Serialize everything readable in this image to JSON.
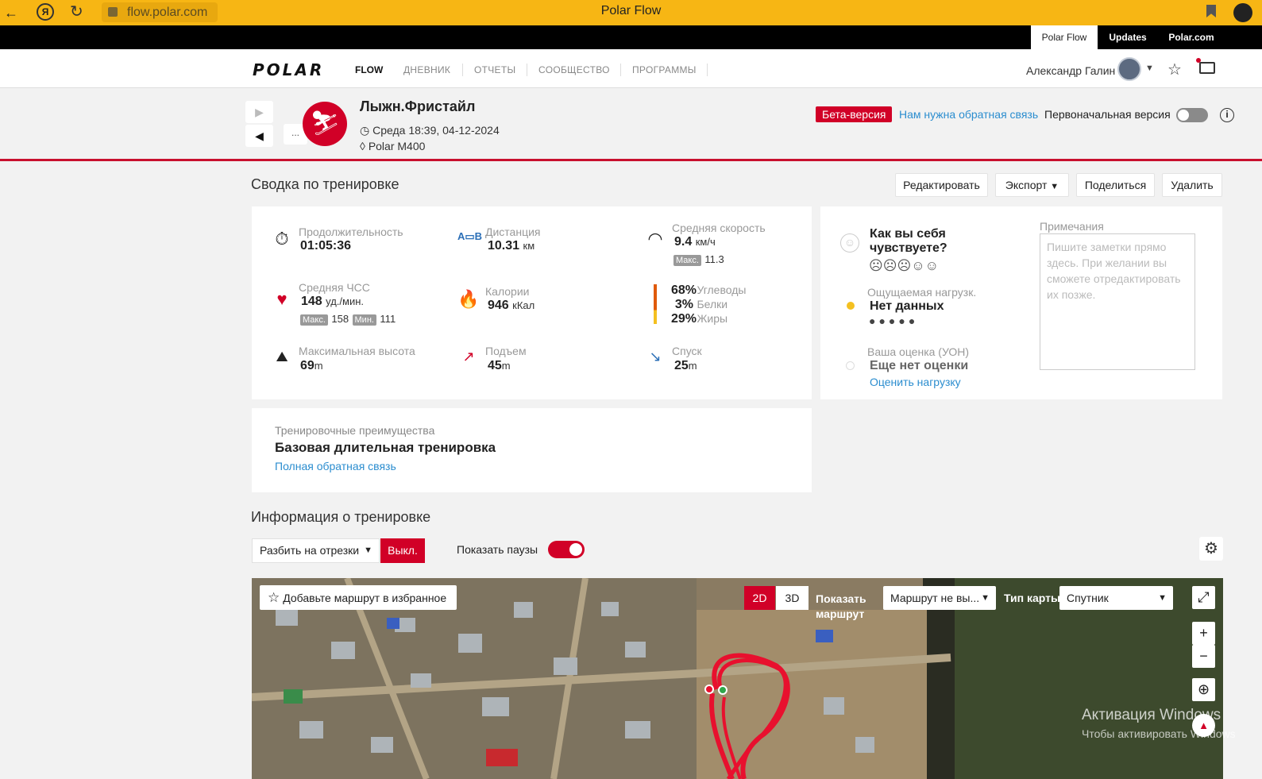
{
  "browser": {
    "url": "flow.polar.com",
    "title": "Polar Flow",
    "back_icon": "arrow-left-icon",
    "reload_icon": "reload-icon"
  },
  "toplinks": {
    "flow": "Polar Flow",
    "updates": "Updates",
    "polar": "Polar.com"
  },
  "nav": {
    "logo": "POLAR",
    "flow": "FLOW",
    "items": [
      "ДНЕВНИК",
      "ОТЧЕТЫ",
      "СООБЩЕСТВО",
      "ПРОГРАММЫ"
    ],
    "user": "Александр Галин"
  },
  "session": {
    "title": "Лыжн.Фристайл",
    "date": "Среда 18:39, 04-12-2024",
    "device": "Polar M400",
    "more": "...",
    "beta": "Бета-версия",
    "feedback": "Нам нужна обратная связь",
    "original_version": "Первоначальная версия"
  },
  "summary": {
    "title": "Сводка по тренировке",
    "buttons": {
      "edit": "Редактировать",
      "export": "Экспорт",
      "share": "Поделиться",
      "delete": "Удалить"
    },
    "duration": {
      "label": "Продолжительность",
      "value": "01:05:36"
    },
    "distance": {
      "label": "Дистанция",
      "value": "10.31",
      "unit": "км"
    },
    "avg_speed": {
      "label": "Средняя скорость",
      "value": "9.4",
      "unit": "км/ч",
      "max_label": "Макс.",
      "max_value": "11.3"
    },
    "avg_hr": {
      "label": "Средняя ЧСС",
      "value": "148",
      "unit": "уд./мин.",
      "max_label": "Макс.",
      "max_value": "158",
      "min_label": "Мин.",
      "min_value": "111"
    },
    "calories": {
      "label": "Калории",
      "value": "946",
      "unit": "кКал"
    },
    "macros": [
      {
        "pct": "68%",
        "name": "Углеводы"
      },
      {
        "pct": "3%",
        "name": "Белки"
      },
      {
        "pct": "29%",
        "name": "Жиры"
      }
    ],
    "max_alt": {
      "label": "Максимальная высота",
      "value": "69",
      "unit": "m"
    },
    "ascent": {
      "label": "Подъем",
      "value": "45",
      "unit": "m"
    },
    "descent": {
      "label": "Спуск",
      "value": "25",
      "unit": "m"
    }
  },
  "feeling": {
    "question": "Как вы себя чувствуете?",
    "perceived_label": "Ощущаемая нагрузк.",
    "perceived_value": "Нет данных",
    "rpe_label": "Ваша оценка (УОН)",
    "rpe_value": "Еще нет оценки",
    "rpe_link": "Оценить нагрузку",
    "notes_label": "Примечания",
    "notes_placeholder": "Пишите заметки прямо здесь. При желании вы сможете отредактировать их позже."
  },
  "benefit": {
    "label": "Тренировочные преимущества",
    "value": "Базовая длительная тренировка",
    "link": "Полная обратная связь"
  },
  "info": {
    "title": "Информация о тренировке",
    "split": "Разбить на отрезки",
    "off": "Выкл.",
    "show_pauses": "Показать паузы"
  },
  "map": {
    "favorite": "Добавьте маршрут в избранное",
    "mode_2d": "2D",
    "mode_3d": "3D",
    "show_route": "Показать маршрут",
    "route_select": "Маршрут не вы...",
    "map_type_label": "Тип карты",
    "map_type": "Спутник",
    "zoom_in": "+",
    "zoom_out": "−"
  },
  "watermark": {
    "line1": "Активация Windows",
    "line2": "Чтобы активировать Windows"
  },
  "colors": {
    "accent": "#d10027",
    "browser_bar": "#f7b614",
    "link": "#2b8dcf"
  }
}
